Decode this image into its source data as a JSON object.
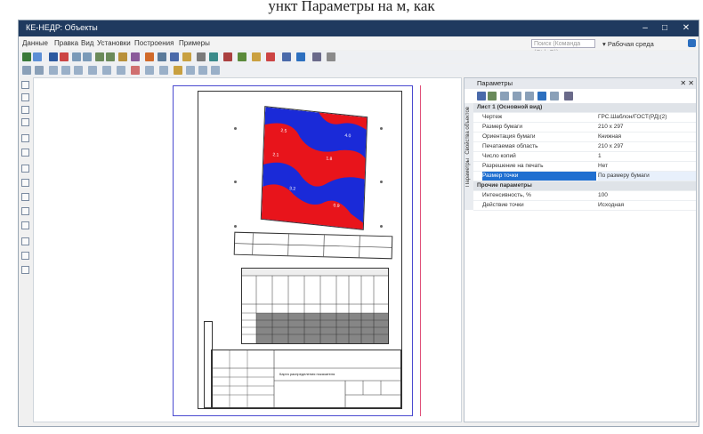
{
  "caption": "ункт      Параметры       на         м, как        ",
  "window": {
    "title": "КЕ-НЕДР: Объекты",
    "min": "–",
    "max": "□",
    "close": "✕"
  },
  "menu": [
    "Данные",
    "Правка",
    "Вид",
    "Установки",
    "Построения",
    "Примеры"
  ],
  "search_placeholder": "Поиск (Команда (Ctrl+Q))",
  "right_label": "▾  Рабочая среда",
  "panel": {
    "title": "Параметры",
    "close": "✕ ✕",
    "side_tabs": [
      "Свойства объектов",
      "Параметры"
    ],
    "rows": [
      {
        "k": "Лист 1 (Основной вид)",
        "v": "",
        "group": true
      },
      {
        "k": "Чертеж",
        "v": "ГРС.Шаблон/ГОСТ(РД)(2)"
      },
      {
        "k": "Размер бумаги",
        "v": "210 x 297"
      },
      {
        "k": "Ориентация бумаги",
        "v": "Книжная"
      },
      {
        "k": "Печатаемая область",
        "v": "210 x 297"
      },
      {
        "k": "Число копий",
        "v": "1"
      },
      {
        "k": "Разрешение на печать",
        "v": "Нет"
      },
      {
        "k": "Размер точки",
        "v": "По размеру бумаги",
        "sel": true
      },
      {
        "k": "Прочие параметры",
        "v": "",
        "group": true
      },
      {
        "k": "Интенсивность, %",
        "v": "100"
      },
      {
        "k": "Действие точки",
        "v": "Исходная"
      }
    ]
  },
  "map_labels": [
    "2.5",
    "1.8",
    "3.2",
    "0.9",
    "2.1",
    "4.0"
  ],
  "stamp_title": "Карта распределения показателя",
  "colors": {
    "accent": "#1f3a5f",
    "map_red": "#e8141b",
    "map_blue": "#1a2ad8",
    "selection": "#1f6fd0"
  }
}
